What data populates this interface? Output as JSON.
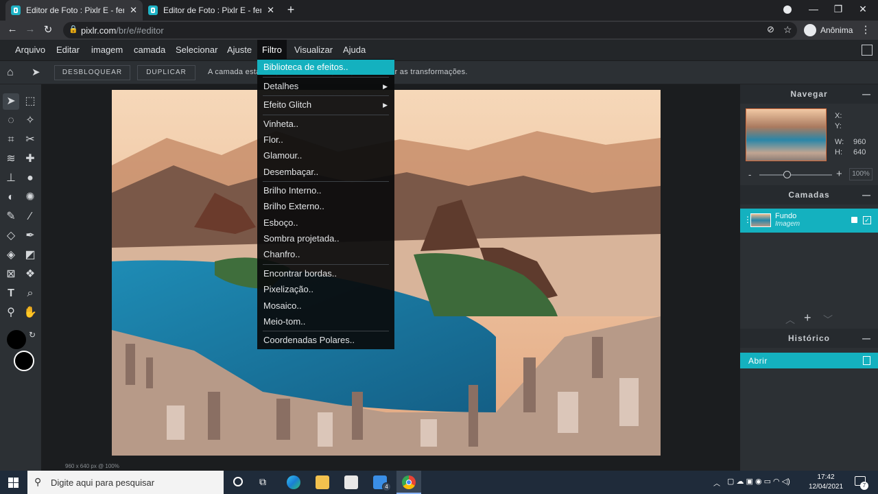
{
  "browser": {
    "tabs": [
      {
        "title": "Editor de Foto : Pixlr E - ferramenta",
        "active": true
      },
      {
        "title": "Editor de Foto : Pixlr E - ferramenta",
        "active": false
      }
    ],
    "url_host": "pixlr.com",
    "url_path": "/br/e/#editor",
    "profile": "Anônima"
  },
  "menubar": [
    "Arquivo",
    "Editar",
    "imagem",
    "camada",
    "Selecionar",
    "Ajuste",
    "Filtro",
    "Visualizar",
    "Ajuda"
  ],
  "toolbar": {
    "unlock": "DESBLOQUEAR",
    "duplicate": "DUPLICAR",
    "info": "A camada está bloqueada. Desbloqueie para habilitar as transformações."
  },
  "filter_menu": [
    {
      "label": "Biblioteca de efeitos..",
      "highlight": true
    },
    {
      "label": "Detalhes",
      "submenu": true
    },
    {
      "label": "Efeito Glitch",
      "submenu": true
    },
    {
      "label": "Vinheta.."
    },
    {
      "label": "Flor.."
    },
    {
      "label": "Glamour.."
    },
    {
      "label": "Desembaçar.."
    },
    {
      "label": "Brilho Interno.."
    },
    {
      "label": "Brilho Externo.."
    },
    {
      "label": "Esboço.."
    },
    {
      "label": "Sombra projetada.."
    },
    {
      "label": "Chanfro.."
    },
    {
      "label": "Encontrar bordas.."
    },
    {
      "label": "Pixelização.."
    },
    {
      "label": "Mosaico.."
    },
    {
      "label": "Meio-tom.."
    },
    {
      "label": "Coordenadas Polares.."
    }
  ],
  "navigator": {
    "title": "Navegar",
    "x_label": "X:",
    "y_label": "Y:",
    "w_label": "W:",
    "h_label": "H:",
    "width": "960",
    "height": "640",
    "zoom": "100%",
    "zoom_out": "-",
    "zoom_in": "+"
  },
  "layers": {
    "title": "Camadas",
    "items": [
      {
        "name": "Fundo",
        "type": "Imagem"
      }
    ]
  },
  "history": {
    "title": "Histórico",
    "items": [
      "Abrir"
    ]
  },
  "status": "960 x 640 px @ 100%",
  "taskbar": {
    "search_placeholder": "Digite aqui para pesquisar",
    "time": "17:42",
    "date": "12/04/2021",
    "mail_badge": "4",
    "notif_badge": "7"
  }
}
